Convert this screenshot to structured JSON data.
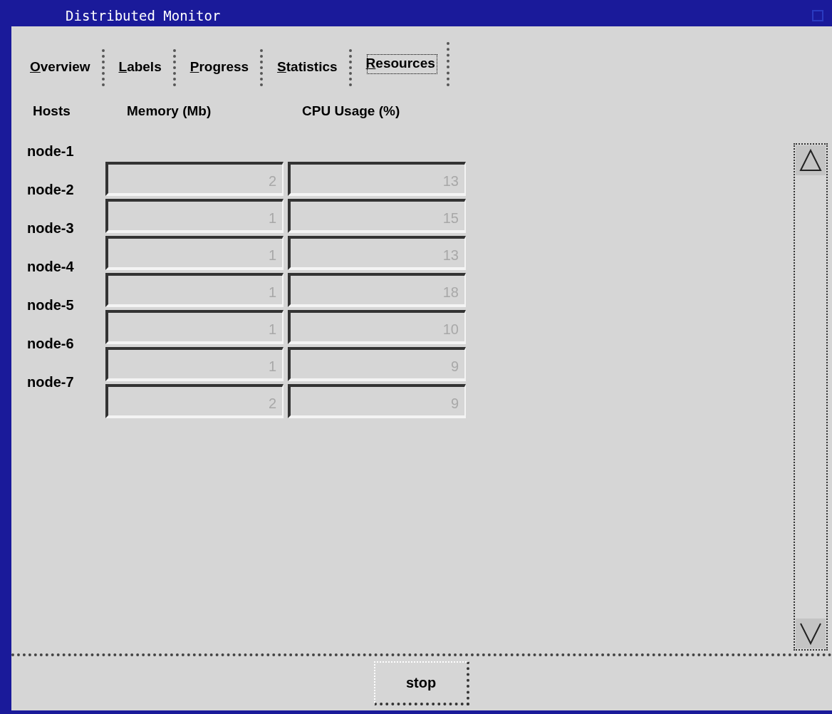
{
  "window": {
    "title": "Distributed Monitor"
  },
  "tabs": [
    {
      "label": "Overview",
      "selected": false
    },
    {
      "label": "Labels",
      "selected": false
    },
    {
      "label": "Progress",
      "selected": false
    },
    {
      "label": "Statistics",
      "selected": false
    },
    {
      "label": "Resources",
      "selected": true
    }
  ],
  "columns": [
    "Hosts",
    "Memory (Mb)",
    "CPU Usage (%)"
  ],
  "rows": [
    {
      "host": "node-1",
      "memory": "2",
      "cpu": "13",
      "disabled": true
    },
    {
      "host": "node-2",
      "memory": "1",
      "cpu": "15",
      "disabled": true
    },
    {
      "host": "node-3",
      "memory": "1",
      "cpu": "13",
      "disabled": true
    },
    {
      "host": "node-4",
      "memory": "1",
      "cpu": "18",
      "disabled": true
    },
    {
      "host": "node-5",
      "memory": "1",
      "cpu": "10",
      "disabled": true
    },
    {
      "host": "node-6",
      "memory": "1",
      "cpu": "9",
      "disabled": true
    },
    {
      "host": "node-7",
      "memory": "2",
      "cpu": "9",
      "disabled": true
    }
  ],
  "buttons": [
    "stop"
  ]
}
